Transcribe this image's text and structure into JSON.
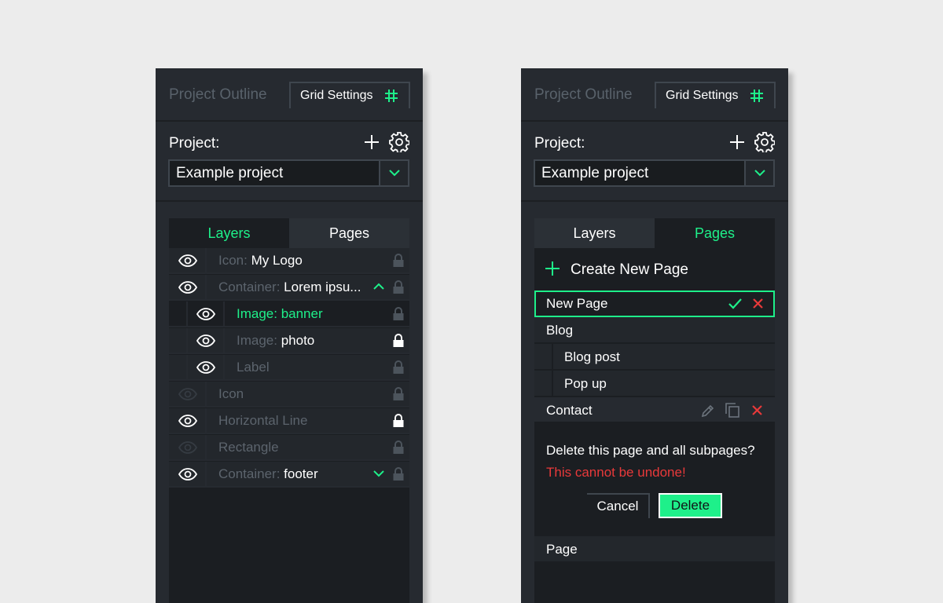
{
  "colors": {
    "accent": "#1ef08a",
    "danger": "#e8393a",
    "panel": "#262a30",
    "list_bg": "#1b1e22",
    "muted": "#5c646d"
  },
  "left_panel": {
    "tabs": {
      "outline": "Project Outline",
      "grid": "Grid Settings"
    },
    "project_label": "Project:",
    "project_value": "Example project",
    "list_tabs": {
      "layers": "Layers",
      "pages": "Pages",
      "active": "layers"
    },
    "layers": [
      {
        "kind": "Icon:",
        "name": "My Logo",
        "indent": 0,
        "visible": true,
        "locked": false
      },
      {
        "kind": "Container:",
        "name": "Lorem ipsu...",
        "indent": 0,
        "visible": true,
        "locked": false,
        "chevron": "up"
      },
      {
        "kind": "Image: banner",
        "name": "",
        "indent": 1,
        "visible": true,
        "locked": false,
        "highlighted": true
      },
      {
        "kind": "Image:",
        "name": "photo",
        "indent": 1,
        "visible": true,
        "locked": true
      },
      {
        "kind": "Label",
        "name": "",
        "indent": 1,
        "visible": true,
        "locked": false
      },
      {
        "kind": "Icon",
        "name": "",
        "indent": 0,
        "visible": false,
        "locked": false
      },
      {
        "kind": "Horizontal Line",
        "name": "",
        "indent": 0,
        "visible": true,
        "locked": true
      },
      {
        "kind": "Rectangle",
        "name": "",
        "indent": 0,
        "visible": false,
        "locked": false
      },
      {
        "kind": "Container:",
        "name": "footer",
        "indent": 0,
        "visible": true,
        "locked": false,
        "chevron": "down"
      }
    ]
  },
  "right_panel": {
    "tabs": {
      "outline": "Project Outline",
      "grid": "Grid Settings"
    },
    "project_label": "Project:",
    "project_value": "Example project",
    "list_tabs": {
      "layers": "Layers",
      "pages": "Pages",
      "active": "pages"
    },
    "create_new_page": "Create New Page",
    "new_page_value": "New Page",
    "pages": {
      "blog": "Blog",
      "blog_post": "Blog post",
      "pop_up": "Pop up",
      "contact": "Contact",
      "page": "Page"
    },
    "confirm": {
      "message": "Delete this page and all subpages?",
      "warning": "This cannot be undone!",
      "cancel": "Cancel",
      "delete": "Delete"
    }
  }
}
